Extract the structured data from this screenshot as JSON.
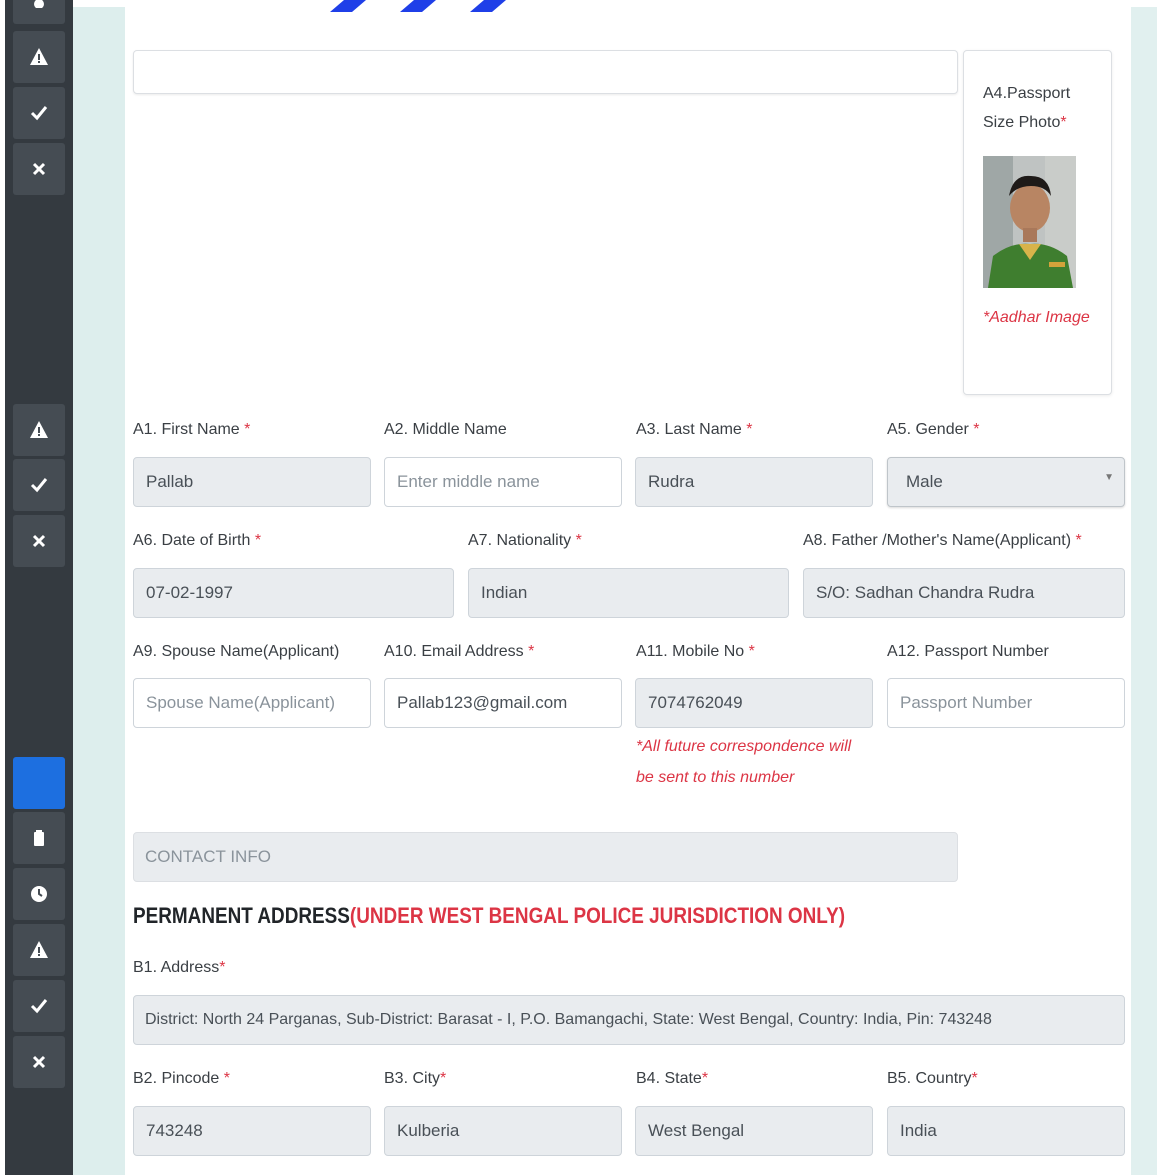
{
  "sidebar": {
    "groups": [
      {
        "icons": [
          "warning-icon",
          "check-icon",
          "close-icon"
        ]
      },
      {
        "icons": [
          "warning-icon",
          "check-icon",
          "close-icon"
        ]
      },
      {
        "icons": [
          "clipboard-active-icon",
          "clipboard-icon",
          "clock-icon",
          "warning-icon",
          "check-icon",
          "close-icon"
        ]
      }
    ]
  },
  "photo": {
    "label": "A4.Passport Size Photo",
    "required_mark": "*",
    "aadhar_note": "*Aadhar Image"
  },
  "applicant": {
    "first_name": {
      "label": "A1. First Name",
      "req": " *",
      "value": "Pallab"
    },
    "middle_name": {
      "label": "A2. Middle Name",
      "placeholder": "Enter middle name"
    },
    "last_name": {
      "label": "A3. Last Name",
      "req": " *",
      "value": "Rudra"
    },
    "gender": {
      "label": "A5. Gender",
      "req": " *",
      "value": "Male"
    },
    "dob": {
      "label": "A6. Date of Birth",
      "req": " *",
      "value": "07-02-1997"
    },
    "nationality": {
      "label": "A7. Nationality",
      "req": " *",
      "value": "Indian"
    },
    "parent_name": {
      "label": "A8. Father /Mother's Name(Applicant)",
      "req": " *",
      "value": "S/O: Sadhan Chandra Rudra"
    },
    "spouse_name": {
      "label": "A9. Spouse Name(Applicant)",
      "placeholder": "Spouse Name(Applicant)"
    },
    "email": {
      "label": "A10. Email Address",
      "req": " *",
      "value": "Pallab123@gmail.com"
    },
    "mobile": {
      "label": "A11. Mobile No",
      "req": " *",
      "value": "7074762049",
      "note": "*All future correspondence will be sent to this number"
    },
    "passport": {
      "label": "A12. Passport Number",
      "placeholder": "Passport Number"
    }
  },
  "contact_info": {
    "label": "CONTACT INFO"
  },
  "permanent_address": {
    "heading": "PERMANENT ADDRESS",
    "heading_note": "(UNDER WEST BENGAL POLICE JURISDICTION ONLY)",
    "address": {
      "label": "B1. Address",
      "req": "*",
      "value": "District: North 24 Parganas, Sub-District: Barasat - I, P.O. Bamangachi, State: West Bengal, Country: India, Pin: 743248"
    },
    "pincode": {
      "label": "B2. Pincode",
      "req": " *",
      "value": "743248"
    },
    "city": {
      "label": "B3. City",
      "req": "*",
      "value": "Kulberia"
    },
    "state": {
      "label": "B4. State",
      "req": "*",
      "value": "West Bengal"
    },
    "country": {
      "label": "B5. Country",
      "req": "*",
      "value": "India"
    }
  },
  "colors": {
    "sidebar": "#343a40",
    "required": "#dc3545",
    "readonly_bg": "#e9ecef",
    "accent": "#1d6fe0"
  }
}
